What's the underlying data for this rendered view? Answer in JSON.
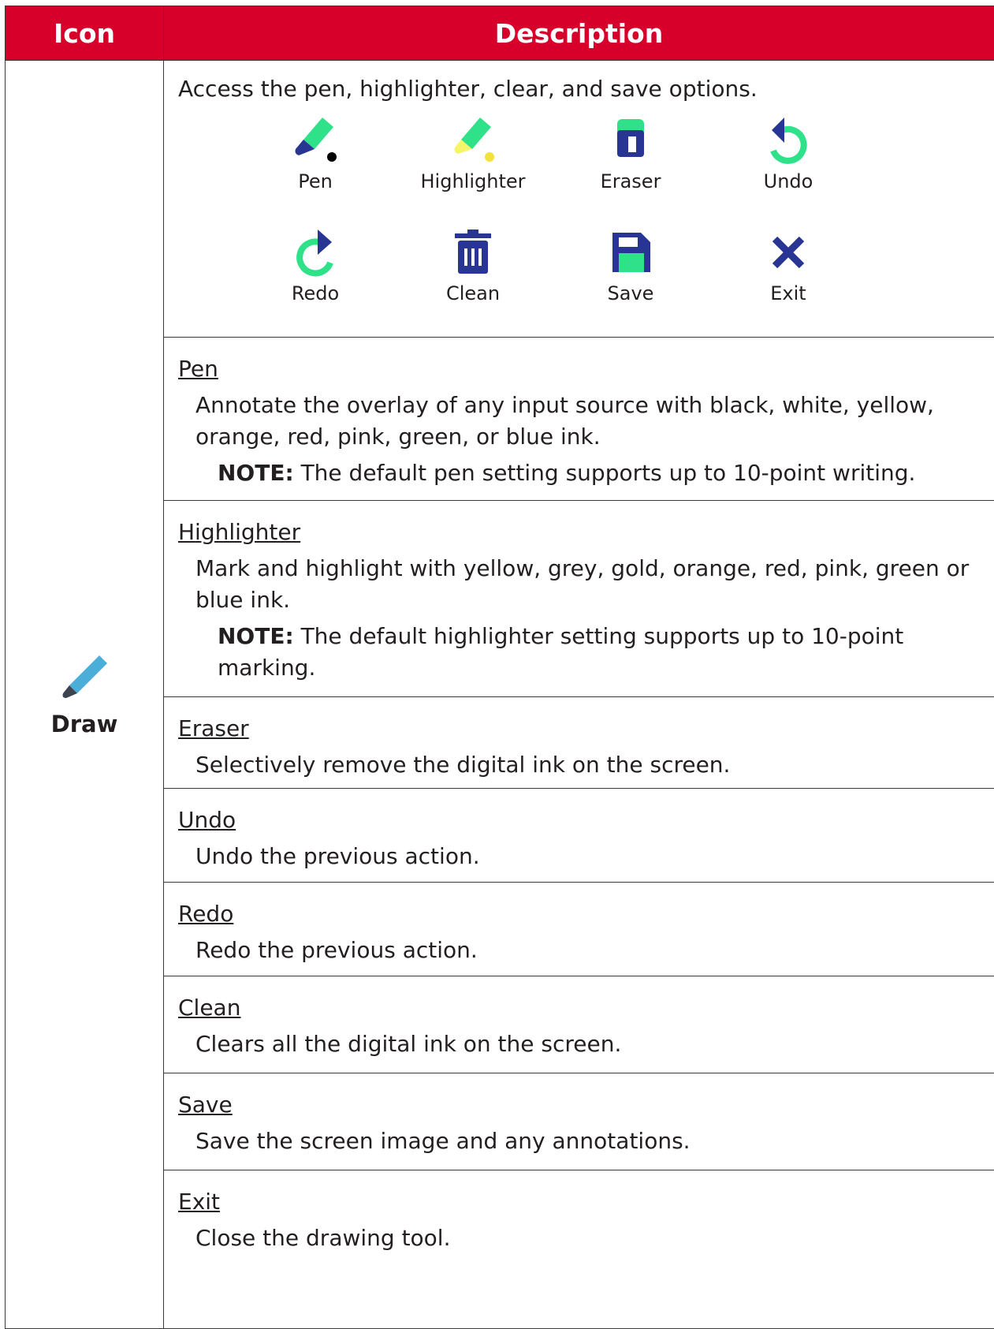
{
  "header": {
    "icon_col": "Icon",
    "description_col": "Description"
  },
  "row": {
    "icon_label": "Draw",
    "icon_name": "pen-icon",
    "intro": "Access the pen, highlighter, clear, and save options.",
    "tools": [
      {
        "label": "Pen",
        "icon": "pen-icon"
      },
      {
        "label": "Highlighter",
        "icon": "highlighter-icon"
      },
      {
        "label": "Eraser",
        "icon": "eraser-icon"
      },
      {
        "label": "Undo",
        "icon": "undo-icon"
      },
      {
        "label": "Redo",
        "icon": "redo-icon"
      },
      {
        "label": "Clean",
        "icon": "trash-icon"
      },
      {
        "label": "Save",
        "icon": "save-icon"
      },
      {
        "label": "Exit",
        "icon": "close-icon"
      }
    ],
    "sections": [
      {
        "title": "Pen",
        "desc": "Annotate the overlay of any input source with black, white, yellow, orange, red, pink, green, or blue ink.",
        "note_label": "NOTE:",
        "note": " The default pen setting supports up to 10-point writing."
      },
      {
        "title": "Highlighter",
        "desc": "Mark and highlight with yellow, grey, gold, orange, red, pink, green or blue ink.",
        "note_label": "NOTE:",
        "note": " The default highlighter setting supports up to 10-point marking."
      },
      {
        "title": "Eraser",
        "desc": "Selectively remove the digital ink on the screen."
      },
      {
        "title": "Undo",
        "desc": "Undo the previous action."
      },
      {
        "title": "Redo",
        "desc": "Redo the previous action."
      },
      {
        "title": "Clean",
        "desc": "Clears all the digital ink on the screen."
      },
      {
        "title": "Save",
        "desc": "Save the screen image and any annotations."
      },
      {
        "title": "Exit",
        "desc": "Close the drawing tool."
      }
    ]
  },
  "colors": {
    "header_bg": "#d6002a",
    "accent_green": "#2fe28a",
    "navy": "#283593",
    "draw_icon_blue": "#4aaed8"
  }
}
